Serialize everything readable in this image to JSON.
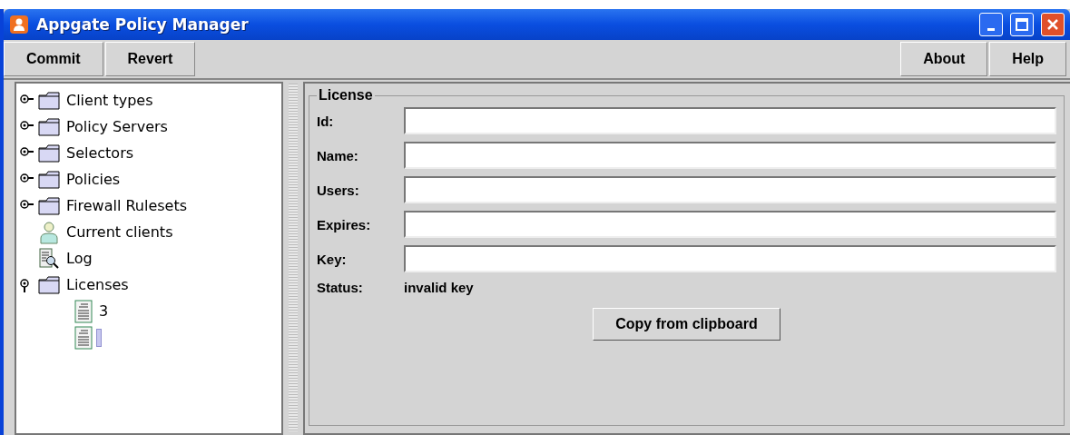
{
  "window": {
    "title": "Appgate Policy Manager"
  },
  "toolbar": {
    "left": [
      "Commit",
      "Revert"
    ],
    "right": [
      "About",
      "Help"
    ]
  },
  "tree": [
    {
      "kind": "folder",
      "label": "Client types",
      "expanded": false
    },
    {
      "kind": "folder",
      "label": "Policy Servers",
      "expanded": false
    },
    {
      "kind": "folder",
      "label": "Selectors",
      "expanded": false
    },
    {
      "kind": "folder",
      "label": "Policies",
      "expanded": false
    },
    {
      "kind": "folder",
      "label": "Firewall Rulesets",
      "expanded": false
    },
    {
      "kind": "person",
      "label": "Current clients"
    },
    {
      "kind": "log",
      "label": "Log"
    },
    {
      "kind": "folder",
      "label": "Licenses",
      "expanded": true,
      "children": [
        {
          "kind": "document",
          "label": "3",
          "selected": false
        },
        {
          "kind": "document",
          "selected": true
        }
      ]
    }
  ],
  "license": {
    "title": "License",
    "fields": [
      {
        "label": "Id:"
      },
      {
        "label": "Name:"
      },
      {
        "label": "Users:"
      },
      {
        "label": "Expires:"
      },
      {
        "label": "Key:"
      }
    ],
    "status_label": "Status:",
    "status_value": "invalid key",
    "button": "Copy from clipboard"
  }
}
